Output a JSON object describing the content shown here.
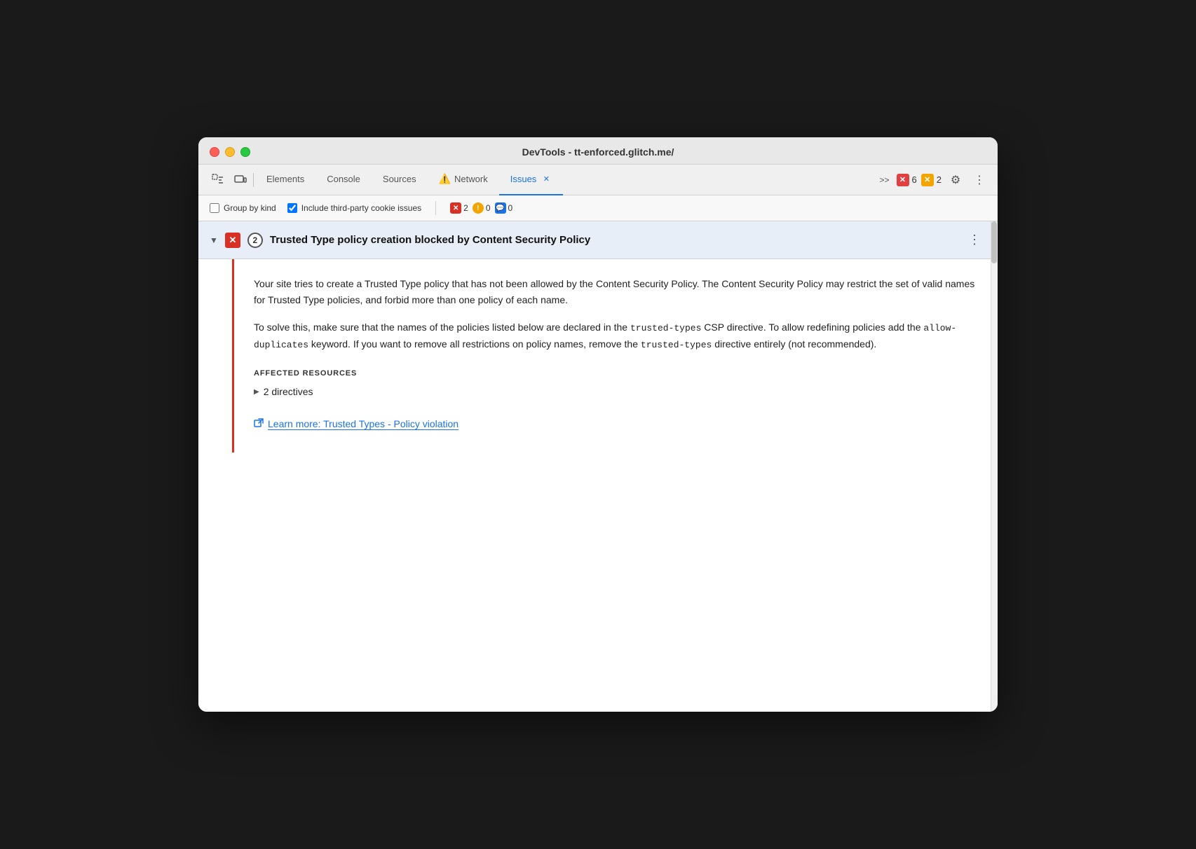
{
  "window": {
    "title": "DevTools - tt-enforced.glitch.me/"
  },
  "toolbar": {
    "tabs": [
      {
        "id": "elements",
        "label": "Elements",
        "active": false
      },
      {
        "id": "console",
        "label": "Console",
        "active": false
      },
      {
        "id": "sources",
        "label": "Sources",
        "active": false
      },
      {
        "id": "network",
        "label": "Network",
        "active": false,
        "warning": true
      },
      {
        "id": "issues",
        "label": "Issues",
        "active": true,
        "closeable": true
      }
    ],
    "more_label": ">>",
    "error_count": "6",
    "warning_count": "2"
  },
  "secondary_toolbar": {
    "group_by_kind_label": "Group by kind",
    "include_third_party_label": "Include third-party cookie issues",
    "error_count": "2",
    "warning_count": "0",
    "info_count": "0"
  },
  "issue": {
    "title": "Trusted Type policy creation blocked by Content Security Policy",
    "count": "2",
    "description_p1": "Your site tries to create a Trusted Type policy that has not been allowed by the Content Security Policy. The Content Security Policy may restrict the set of valid names for Trusted Type policies, and forbid more than one policy of each name.",
    "description_p2_prefix": "To solve this, make sure that the names of the policies listed below are declared in the ",
    "description_p2_code1": "trusted-types",
    "description_p2_mid": " CSP directive. To allow redefining policies add the ",
    "description_p2_code2": "allow-duplicates",
    "description_p2_suffix": " keyword. If you want to remove all restrictions on policy names, remove the ",
    "description_p2_code3": "trusted-types",
    "description_p2_end": " directive entirely (not recommended).",
    "affected_resources_label": "AFFECTED RESOURCES",
    "directives_label": "2 directives",
    "learn_more_text": "Learn more: Trusted Types - Policy violation",
    "learn_more_url": "#"
  }
}
